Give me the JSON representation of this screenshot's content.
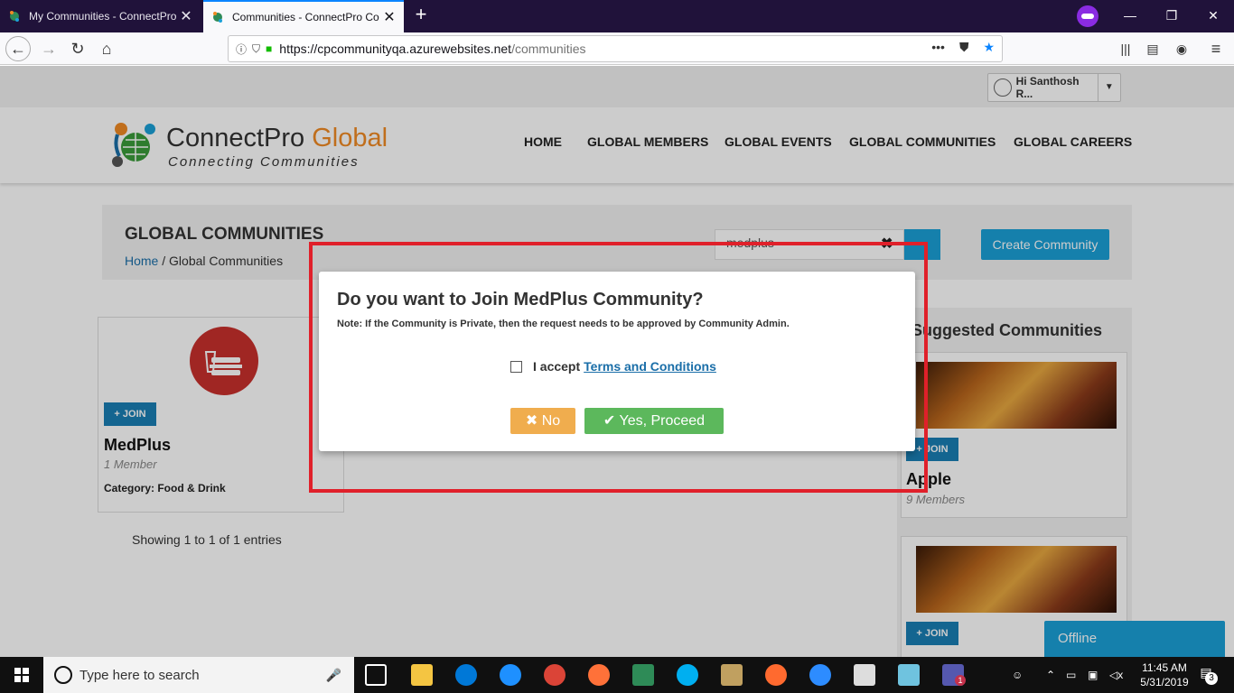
{
  "browser": {
    "tabs": [
      {
        "title": "My Communities - ConnectPro",
        "active": false
      },
      {
        "title": "Communities - ConnectPro Co",
        "active": true
      }
    ],
    "url_host": "https://cpcommunityqa.azurewebsites.net",
    "url_path": "/communities"
  },
  "site": {
    "user_greeting": "Hi Santhosh R...",
    "logo_brand_main": "ConnectPro",
    "logo_brand_accent": "Global",
    "logo_tagline": "Connecting Communities",
    "nav": [
      "HOME",
      "GLOBAL MEMBERS",
      "GLOBAL EVENTS",
      "GLOBAL COMMUNITIES",
      "GLOBAL CAREERS"
    ]
  },
  "page_header": {
    "title": "GLOBAL COMMUNITIES",
    "breadcrumb_home": "Home",
    "breadcrumb_sep": " / ",
    "breadcrumb_current": "Global Communities",
    "search_value": "medplus",
    "create_button": "Create Community"
  },
  "community_card": {
    "join_label": "+ JOIN",
    "name": "MedPlus",
    "members": "1 Member",
    "category": "Category: Food & Drink"
  },
  "listing_info": "Showing 1 to 1 of 1 entries",
  "sidebar": {
    "title": "Suggested Communities",
    "items": [
      {
        "join_label": "+ JOIN",
        "name": "Apple",
        "members": "9 Members"
      },
      {
        "join_label": "+ JOIN",
        "name": "",
        "members": ""
      }
    ]
  },
  "chat": {
    "status": "Offline"
  },
  "dialog": {
    "title": "Do you want to Join MedPlus Community?",
    "note": "Note: If the Community is Private, then the request needs to be approved by Community Admin.",
    "accept_prefix": "I accept",
    "accept_link": "Terms and Conditions",
    "no_button": "✖ No",
    "yes_button": "✔ Yes, Proceed"
  },
  "taskbar": {
    "search_placeholder": "Type here to search",
    "time": "11:45 AM",
    "date": "5/31/2019",
    "notification_count": "3",
    "teams_badge": "1"
  },
  "colors": {
    "accent_blue": "#1ba0d8",
    "highlight_red": "#e0202a",
    "no_orange": "#f0ad4e",
    "yes_green": "#5cb85c"
  }
}
